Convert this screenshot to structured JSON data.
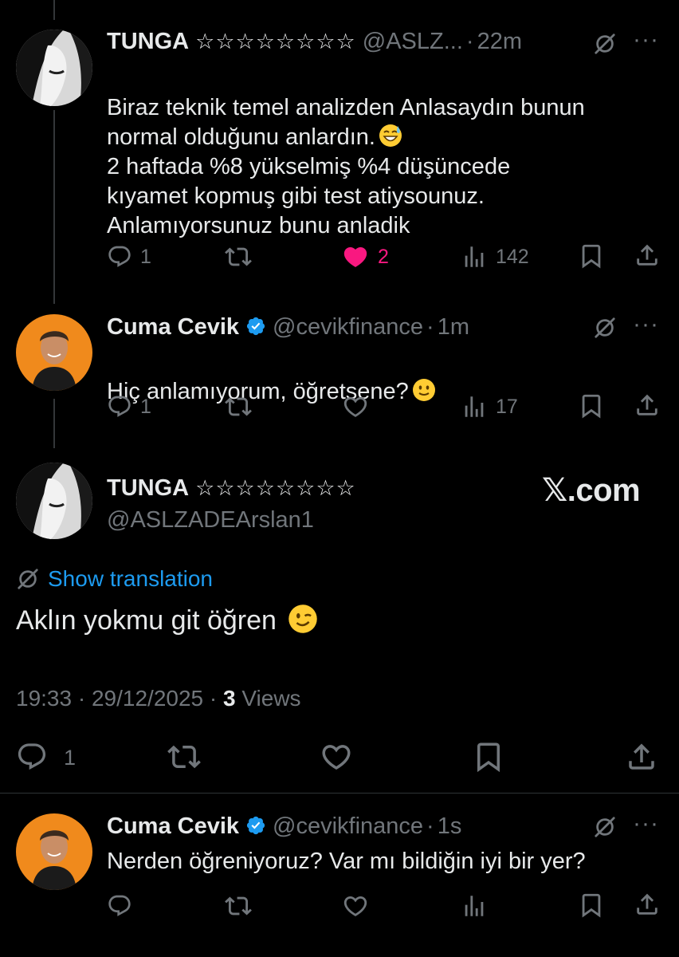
{
  "tweets": [
    {
      "name": "TUNGA",
      "stars": "☆☆☆☆☆☆☆☆",
      "handle": "@ASLZ...",
      "time": "22m",
      "text": "Biraz teknik temel  analizden Anlasaydın bunun\nnormal olduğunu anlardın.",
      "text2": "2 haftada %8 yükselmiş %4 düşüncede\nkıyamet kopmuş gibi test atiysounuz.\nAnlamıyorsunuz  bunu anladik",
      "replies": "1",
      "likes": "2",
      "views": "142"
    },
    {
      "name": "Cuma Cevik",
      "handle": "@cevikfinance",
      "time": "1m",
      "text": "Hiç anlamıyorum, öğretsene?",
      "replies": "1",
      "views": "17"
    },
    {
      "name": "Cuma Cevik",
      "handle": "@cevikfinance",
      "time": "1s",
      "text": "Nerden öğreniyoruz? Var mı bildiğin iyi bir yer?"
    }
  ],
  "focused": {
    "name": "TUNGA",
    "stars": "☆☆☆☆☆☆☆☆",
    "handle": "@ASLZADEArslan1",
    "watermark": "𝕏.com",
    "translation_link": "Show translation",
    "text": "Aklın yokmu git öğren",
    "time": "19:33",
    "date": "29/12/2025",
    "views_count": "3",
    "views_label": "Views",
    "replies": "1"
  },
  "separator": "·",
  "colors": {
    "background": "#000000",
    "text": "#e7e9ea",
    "muted": "#71767b",
    "accent": "#1d9bf0",
    "like": "#f91880",
    "verified": "#1d9bf0"
  },
  "icons": [
    "globe-slash-icon",
    "reply-icon",
    "retweet-icon",
    "heart-icon",
    "views-icon",
    "bookmark-icon",
    "share-icon",
    "verified-icon",
    "more-icon"
  ]
}
